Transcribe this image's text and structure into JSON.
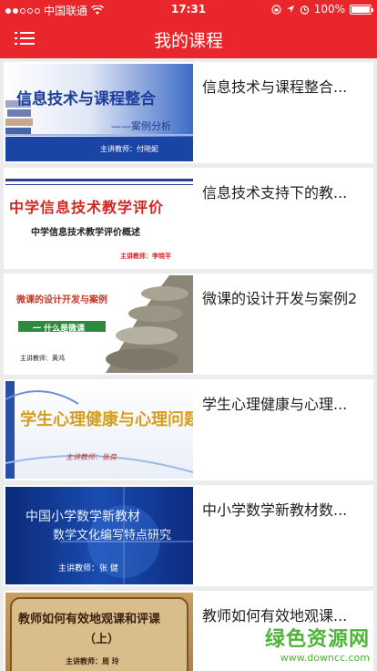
{
  "status_bar": {
    "carrier": "中国联通",
    "time": "17:31",
    "battery": "100%"
  },
  "header": {
    "title": "我的课程",
    "menu_icon": "list-menu-icon"
  },
  "courses": [
    {
      "title": "信息技术与课程整合...",
      "thumb": {
        "headline": "信息技术与课程整合",
        "subline": "——案例分析",
        "teacher": "主讲教师：付晓妮"
      }
    },
    {
      "title": "信息技术支持下的教...",
      "thumb": {
        "headline": "中学信息技术教学评价",
        "subline": "中学信息技术教学评价概述",
        "teacher": "主讲教师：李晓平"
      }
    },
    {
      "title": "微课的设计开发与案例2",
      "thumb": {
        "headline": "微课的设计开发与案例",
        "subline": "一  什么是微课",
        "teacher": "主讲教师：黄鸿"
      }
    },
    {
      "title": "学生心理健康与心理...",
      "thumb": {
        "headline": "学生心理健康与心理问题",
        "teacher": "主讲教师：张良"
      }
    },
    {
      "title": "中小学数学新教材数...",
      "thumb": {
        "headline": "中国小学数学新教材",
        "subline": "数学文化编写特点研究",
        "teacher": "主讲教师：张  健"
      }
    },
    {
      "title": "教师如何有效地观课...",
      "thumb": {
        "headline": "教师如何有效地观课和评课",
        "subline": "（上）",
        "teacher": "主讲教师：周  玲"
      }
    }
  ],
  "watermark": {
    "brand": "绿色资源网",
    "url": "www.downcc.com"
  }
}
